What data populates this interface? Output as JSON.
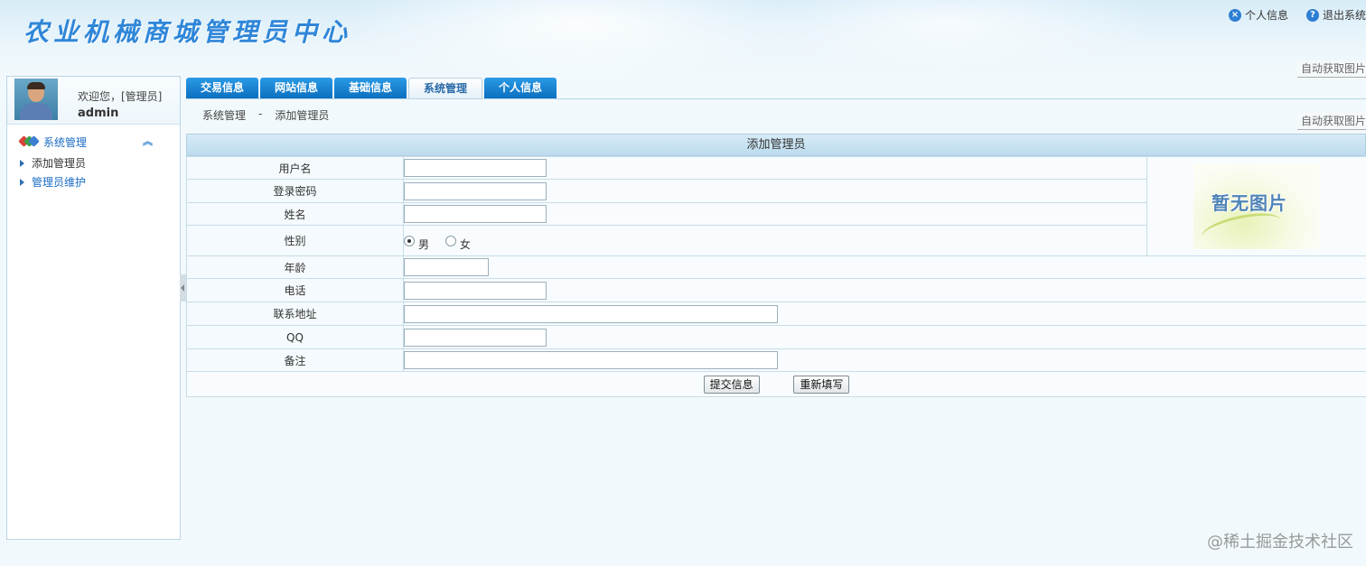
{
  "header": {
    "app_title": "农业机械商城管理员中心",
    "links": [
      {
        "icon": "close-circle-icon",
        "label": "个人信息"
      },
      {
        "icon": "help-circle-icon",
        "label": "退出系统"
      }
    ],
    "auto_image_label_1": "自动获取图片",
    "auto_image_label_2": "自动获取图片"
  },
  "sidebar": {
    "welcome": "欢迎您，[管理员]",
    "username": "admin",
    "menu_title": "系统管理",
    "items": [
      {
        "label": "添加管理员"
      },
      {
        "label": "管理员维护"
      }
    ]
  },
  "tabs": [
    {
      "label": "交易信息",
      "active": false
    },
    {
      "label": "网站信息",
      "active": false
    },
    {
      "label": "基础信息",
      "active": false
    },
    {
      "label": "系统管理",
      "active": true
    },
    {
      "label": "个人信息",
      "active": false
    }
  ],
  "breadcrumb": {
    "section": "系统管理",
    "separator": "-",
    "page": "添加管理员"
  },
  "form": {
    "title": "添加管理员",
    "fields": {
      "username": {
        "label": "用户名",
        "value": ""
      },
      "password": {
        "label": "登录密码",
        "value": ""
      },
      "name": {
        "label": "姓名",
        "value": ""
      },
      "gender": {
        "label": "性别",
        "options": [
          "男",
          "女"
        ],
        "selected": "男"
      },
      "age": {
        "label": "年龄",
        "value": ""
      },
      "phone": {
        "label": "电话",
        "value": ""
      },
      "address": {
        "label": "联系地址",
        "value": ""
      },
      "qq": {
        "label": "QQ",
        "value": ""
      },
      "remark": {
        "label": "备注",
        "value": ""
      }
    },
    "placeholder_image_text": "暂无图片",
    "submit_label": "提交信息",
    "reset_label": "重新填写"
  },
  "watermark": "@稀土掘金技术社区",
  "colors": {
    "tab_blue": "#0b6fc0",
    "link_blue": "#1b6cc4",
    "title_blue": "#2f86d8"
  }
}
